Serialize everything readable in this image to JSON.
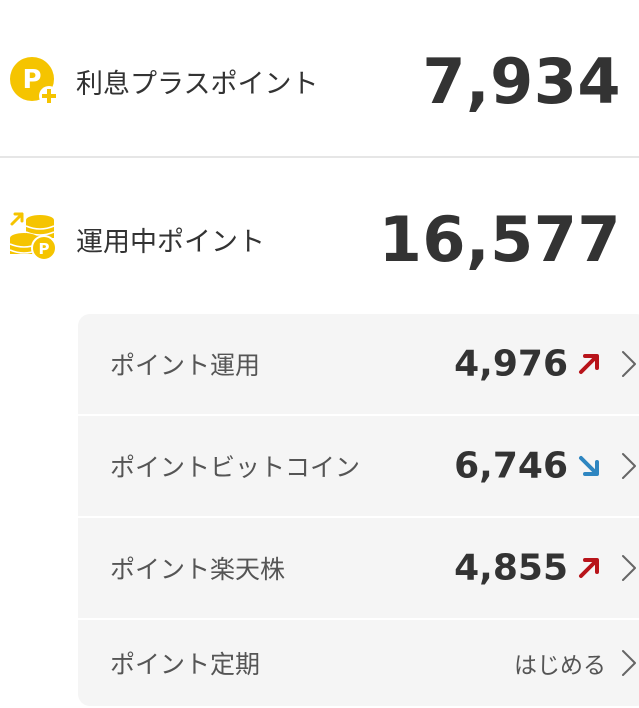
{
  "colors": {
    "accent_yellow": "#f5c400",
    "trend_up": "#b8141a",
    "trend_down": "#2e86c1",
    "text_main": "#333333",
    "text_sub": "#555555",
    "panel_bg": "#f5f5f5"
  },
  "summary": {
    "interest": {
      "icon": "points-plus-icon",
      "label": "利息プラスポイント",
      "value": "7,934"
    },
    "invest": {
      "icon": "coins-points-icon",
      "label": "運用中ポイント",
      "value": "16,577"
    }
  },
  "breakdown": {
    "items": [
      {
        "label": "ポイント運用",
        "value": "4,976",
        "trend": "up"
      },
      {
        "label": "ポイントビットコイン",
        "value": "6,746",
        "trend": "down"
      },
      {
        "label": "ポイント楽天株",
        "value": "4,855",
        "trend": "up"
      },
      {
        "label": "ポイント定期",
        "cta": "はじめる"
      }
    ]
  }
}
